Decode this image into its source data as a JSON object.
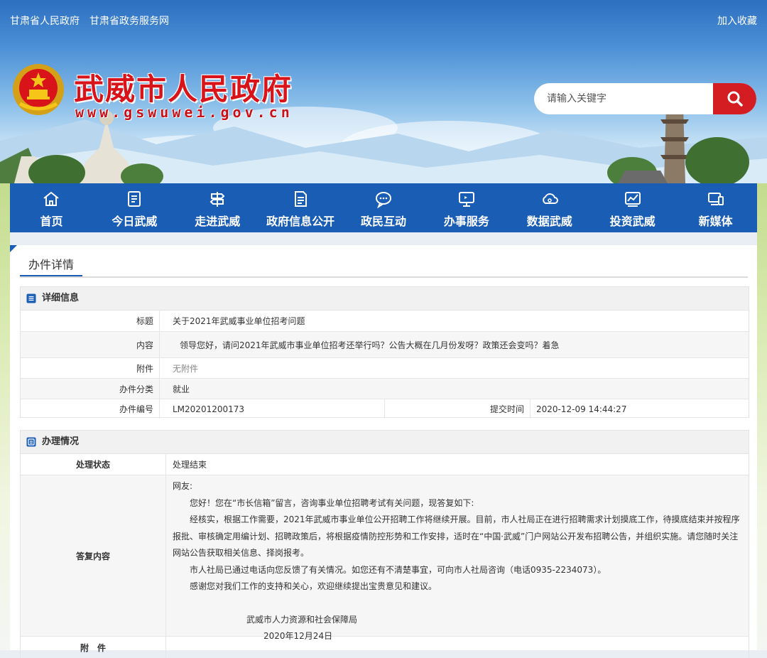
{
  "header": {
    "links": [
      "甘肃省人民政府",
      "甘肃省政务服务网"
    ],
    "bookmark": "加入收藏",
    "site_title": "武威市人民政府",
    "site_url": "www.gswuwei.gov.cn",
    "search_placeholder": "请输入关键字"
  },
  "nav": [
    {
      "label": "首页",
      "icon": "home-icon"
    },
    {
      "label": "今日武威",
      "icon": "news-icon"
    },
    {
      "label": "走进武威",
      "icon": "signpost-icon"
    },
    {
      "label": "政府信息公开",
      "icon": "document-icon"
    },
    {
      "label": "政民互动",
      "icon": "chat-icon"
    },
    {
      "label": "办事服务",
      "icon": "monitor-icon"
    },
    {
      "label": "数据武威",
      "icon": "cloud-icon"
    },
    {
      "label": "投资武威",
      "icon": "chart-icon"
    },
    {
      "label": "新媒体",
      "icon": "devices-icon"
    }
  ],
  "page": {
    "title": "办件详情"
  },
  "details": {
    "heading": "详细信息",
    "title_label": "标题",
    "title_value": "关于2021年武威事业单位招考问题",
    "content_label": "内容",
    "content_value": "领导您好，请问2021年武威市事业单位招考还举行吗？公告大概在几月份发呀？政策还会变吗？着急",
    "attachment_label": "附件",
    "attachment_value": "无附件",
    "category_label": "办件分类",
    "category_value": "就业",
    "number_label": "办件编号",
    "number_value": "LM20201200173",
    "submit_label": "提交时间",
    "submit_value": "2020-12-09 14:44:27"
  },
  "handling": {
    "heading": "办理情况",
    "status_label": "处理状态",
    "status_value": "处理结束",
    "reply_label": "答复内容",
    "reply": {
      "greeting": "网友:",
      "p1": "您好！您在“市长信箱”留言，咨询事业单位招聘考试有关问题，现答复如下:",
      "p2": "经核实，根据工作需要，2021年武威市事业单位公开招聘工作将继续开展。目前，市人社局正在进行招聘需求计划摸底工作，待摸底结束并按程序报批、审核确定用编计划、招聘政策后，将根据疫情防控形势和工作安排，适时在“中国·武威”门户网站公开发布招聘公告，并组织实施。请您随时关注网站公告获取相关信息、择岗报考。",
      "p3": "市人社局已通过电话向您反馈了有关情况。如您还有不清楚事宜，可向市人社局咨询（电话0935-2234073）。",
      "p4": "感谢您对我们工作的支持和关心，欢迎继续提出宝贵意见和建议。",
      "signature": "武威市人力资源和社会保障局",
      "date": "2020年12月24日"
    },
    "attachment_label": "附　件"
  },
  "colors": {
    "nav": "#1a5db5",
    "title_red": "#d8141a",
    "search_button": "#d41d22"
  }
}
